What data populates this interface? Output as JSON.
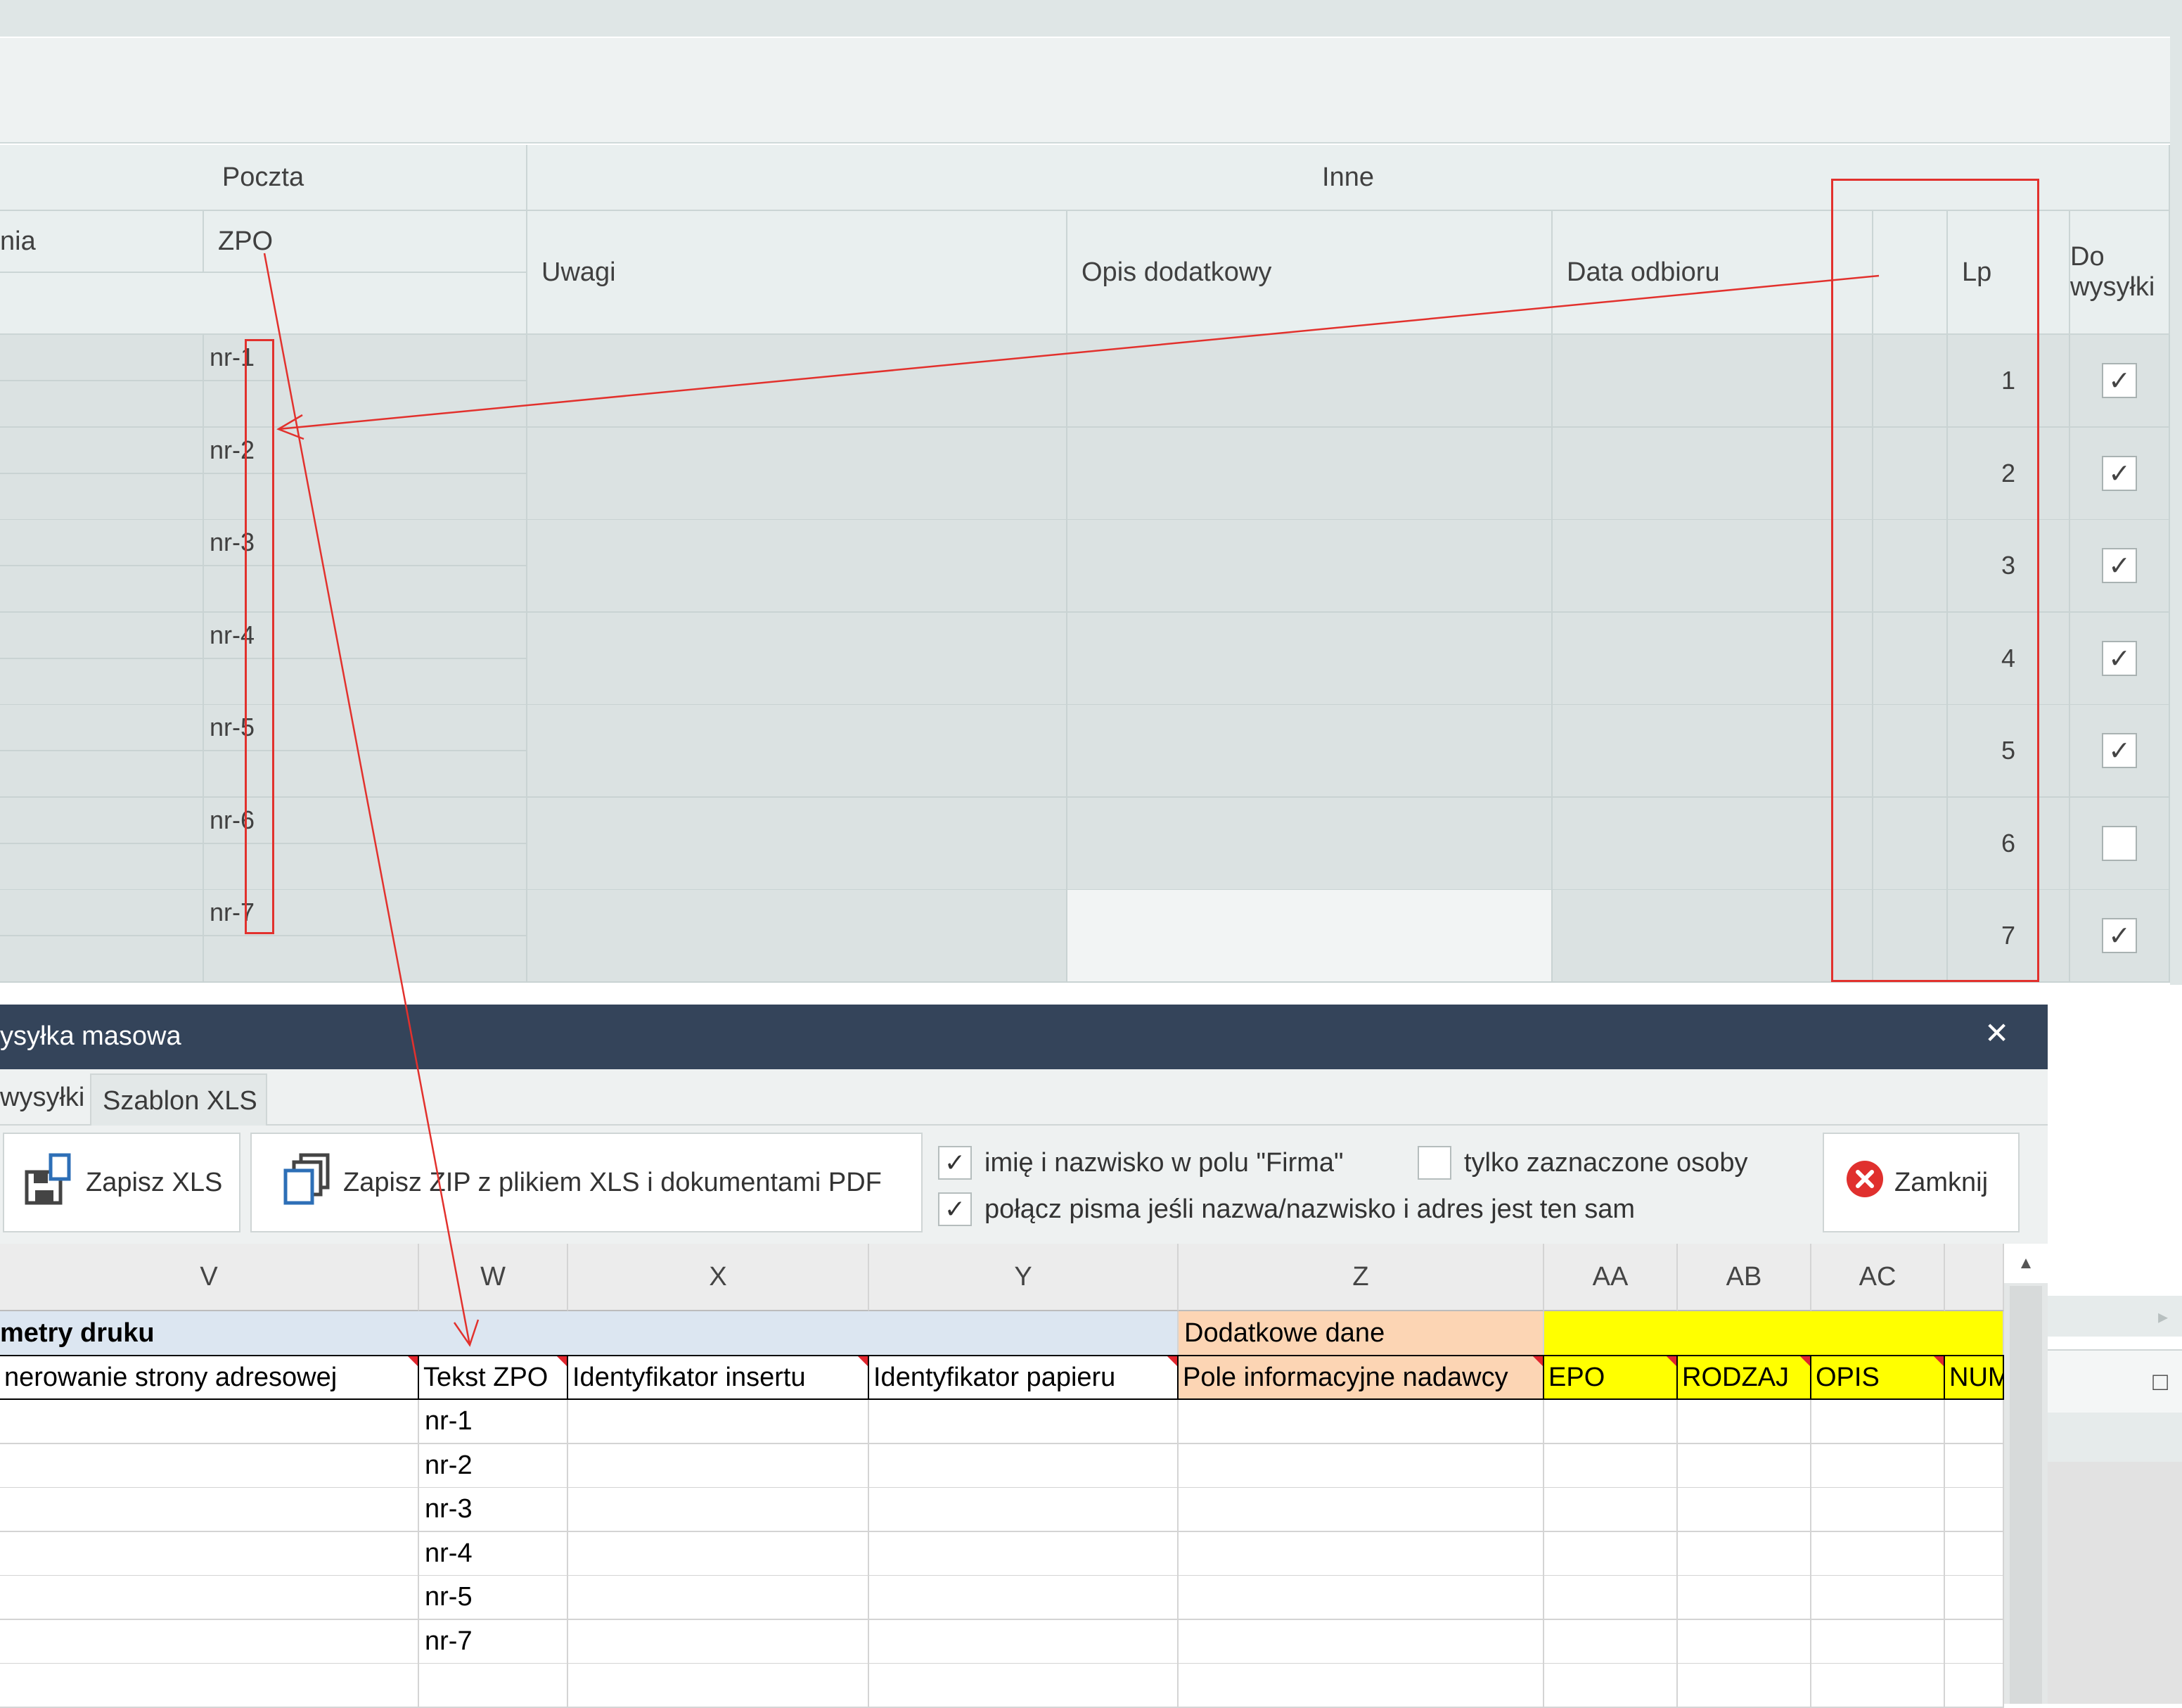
{
  "grid": {
    "group_headers": {
      "poczta": "Poczta",
      "inne": "Inne"
    },
    "columns": {
      "partial": "nia",
      "zpo": "ZPO",
      "uwagi": "Uwagi",
      "opis": "Opis dodatkowy",
      "data_odbioru": "Data odbioru",
      "lp": "Lp",
      "do_wysylki": "Do wysyłki"
    },
    "rows": [
      {
        "zpo": "nr-1",
        "lp": "1",
        "checked": "✓"
      },
      {
        "zpo": "nr-2",
        "lp": "2",
        "checked": "✓"
      },
      {
        "zpo": "nr-3",
        "lp": "3",
        "checked": "✓"
      },
      {
        "zpo": "nr-4",
        "lp": "4",
        "checked": "✓"
      },
      {
        "zpo": "nr-5",
        "lp": "5",
        "checked": "✓"
      },
      {
        "zpo": "nr-6",
        "lp": "6",
        "checked": ""
      },
      {
        "zpo": "nr-7",
        "lp": "7",
        "checked": "✓"
      }
    ],
    "right_arrow_icon": "▸",
    "maximize_icon": "□"
  },
  "dialog": {
    "title": "ysyłka masowa",
    "close_icon": "✕",
    "tabs": [
      "wysyłki",
      "Szablon XLS"
    ],
    "buttons": {
      "save_xls": "Zapisz XLS",
      "save_zip": "Zapisz ZIP z plikiem XLS i dokumentami PDF",
      "close": "Zamknij"
    },
    "options": {
      "name_in_firma": {
        "label": "imię i nazwisko w polu \"Firma\"",
        "checked": "✓"
      },
      "only_selected": {
        "label": "tylko zaznaczone osoby",
        "checked": ""
      },
      "merge_letters": {
        "label": "połącz pisma jeśli nazwa/nazwisko i adres jest ten sam",
        "checked": "✓"
      }
    }
  },
  "sheet": {
    "column_letters": [
      "V",
      "W",
      "X",
      "Y",
      "Z",
      "AA",
      "AB",
      "AC"
    ],
    "group_row": {
      "params": "metry druku",
      "extra": "Dodatkowe dane"
    },
    "header_row": [
      "nerowanie strony adresowej",
      "Tekst ZPO",
      "Identyfikator insertu",
      "Identyfikator papieru",
      "Pole informacyjne nadawcy",
      "EPO",
      "RODZAJ",
      "OPIS",
      "NUM"
    ],
    "data_w": [
      "nr-1",
      "nr-2",
      "nr-3",
      "nr-4",
      "nr-5",
      "nr-7"
    ],
    "scroll_up_icon": "▲"
  },
  "colors": {
    "title_bar": "#34445a",
    "annotation_red": "#e2312d",
    "yellow_header": "#ffff00",
    "orange_header": "#fcd5b4",
    "blue_header": "#dce6f1"
  }
}
